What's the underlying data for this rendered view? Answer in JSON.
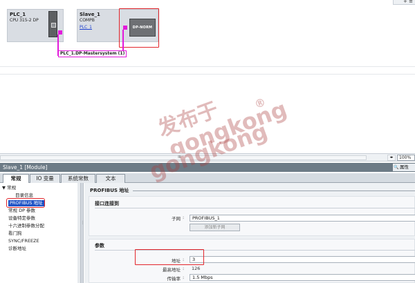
{
  "network": {
    "toolbar_glyph": "+ ≡",
    "plc": {
      "name": "PLC_1",
      "type": "CPU 315-2 DP"
    },
    "slave": {
      "name": "Slave_1",
      "type": "COMPB",
      "link": "PLC_1",
      "module": "DP-NORM"
    },
    "bus_label": "PLC_1.DP-Mastersystem (1)",
    "watermark_cn": "发布于",
    "watermark_en1": "gongkong",
    "watermark_en2": "gongkong",
    "watermark_mark": "®",
    "zoom": "100%",
    "scroll_glyph": "III"
  },
  "inspector": {
    "title": "Slave_1 [Module]",
    "properties_tab": "属性",
    "tabs": [
      "常规",
      "IO 变量",
      "系统常数",
      "文本"
    ],
    "sidebar": {
      "items": [
        {
          "label": "▼ 常规",
          "indent": 0
        },
        {
          "label": "目录信息",
          "indent": 1
        },
        {
          "label": "PROFIBUS 地址",
          "indent": 1,
          "selected": true
        },
        {
          "label": "常规 DP 参数",
          "indent": 1
        },
        {
          "label": "设备特定参数",
          "indent": 1
        },
        {
          "label": "十六进制参数分配",
          "indent": 1
        },
        {
          "label": "看门狗",
          "indent": 1
        },
        {
          "label": "SYNC/FREEZE",
          "indent": 1
        },
        {
          "label": "诊断地址",
          "indent": 1
        }
      ]
    },
    "content": {
      "section_title": "PROFIBUS 地址",
      "interface_title": "接口连接到",
      "subnet_label": "子网",
      "subnet_value": "PROFIBUS_1",
      "add_subnet_button": "添加新子网",
      "params_title": "参数",
      "address_label": "地址",
      "address_value": "3",
      "max_address_label": "最高地址",
      "max_address_value": "126",
      "baud_label": "传输率",
      "baud_value": "1.5 Mbps"
    }
  }
}
